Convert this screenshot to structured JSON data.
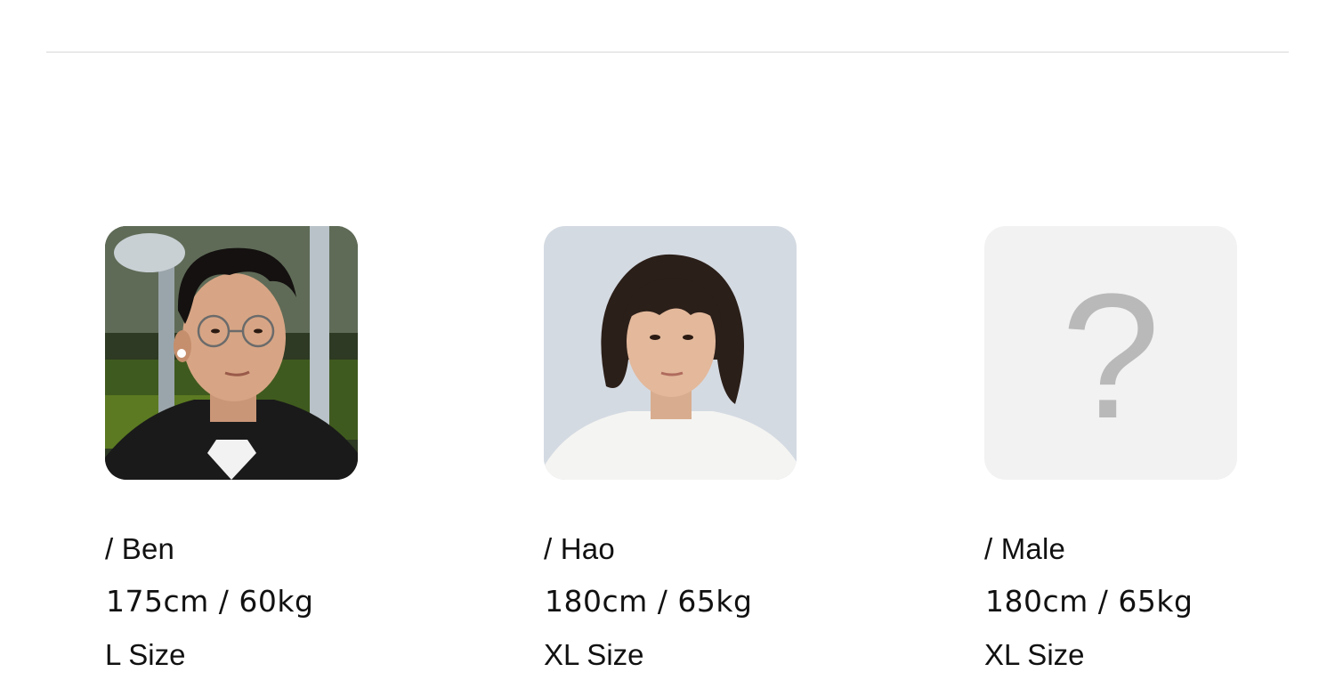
{
  "models": [
    {
      "name": "/ Ben",
      "measurements": "175cm / 60kg",
      "size": "L Size",
      "avatar": "photo"
    },
    {
      "name": "/ Hao",
      "measurements": "180cm / 65kg",
      "size": "XL Size",
      "avatar": "photo"
    },
    {
      "name": "/ Male",
      "measurements": "180cm / 65kg",
      "size": "XL Size",
      "avatar": "question-mark-placeholder",
      "placeholder_symbol": "?"
    }
  ],
  "colors": {
    "divider": "#d8d8d8",
    "placeholder_bg": "#f2f2f2",
    "placeholder_icon": "#b9b9b9",
    "text": "#111111"
  }
}
